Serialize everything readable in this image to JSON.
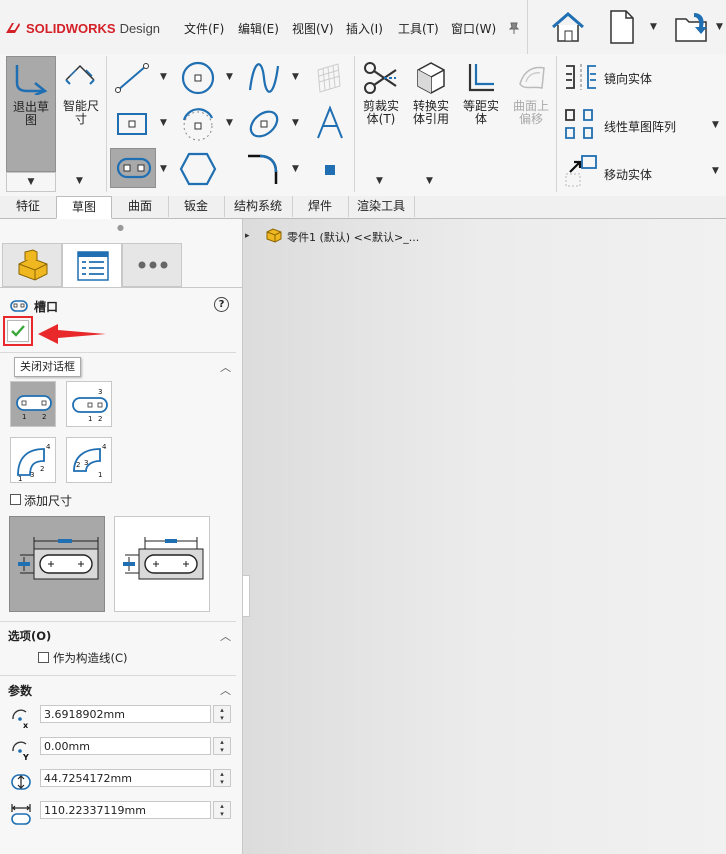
{
  "app": {
    "brand": "SOLIDWORKS",
    "brand_suffix": "Design"
  },
  "menu": [
    "文件(F)",
    "编辑(E)",
    "视图(V)",
    "插入(I)",
    "工具(T)",
    "窗口(W)"
  ],
  "ribbon": {
    "exit_sketch": "退出草\n图",
    "smart_dim": "智能尺\n寸",
    "trim": "剪裁实\n体(T)",
    "convert": "转换实\n体引用",
    "offset": "等距实\n体",
    "surface_offset": "曲面上\n偏移",
    "mirror": "镜向实体",
    "linear_pattern": "线性草图阵列",
    "move": "移动实体"
  },
  "tabs": [
    "特征",
    "草图",
    "曲面",
    "钣金",
    "结构系统",
    "焊件",
    "渲染工具"
  ],
  "tree": {
    "root": "零件1 (默认) <<默认>_..."
  },
  "panel": {
    "title": "槽口",
    "help": "?",
    "tooltip": "关闭对话框",
    "slot_type_label": "槽",
    "add_dimension": "添加尺寸",
    "options_title": "选项(O)",
    "construction": "作为构造线(C)",
    "params_title": "参数",
    "params": [
      {
        "value": "3.6918902mm"
      },
      {
        "value": "0.00mm"
      },
      {
        "value": "44.7254172mm"
      },
      {
        "value": "110.22337119mm"
      }
    ]
  },
  "colors": {
    "accent": "#1f6fb2",
    "red": "#e8282b",
    "check": "#3aa83a"
  }
}
